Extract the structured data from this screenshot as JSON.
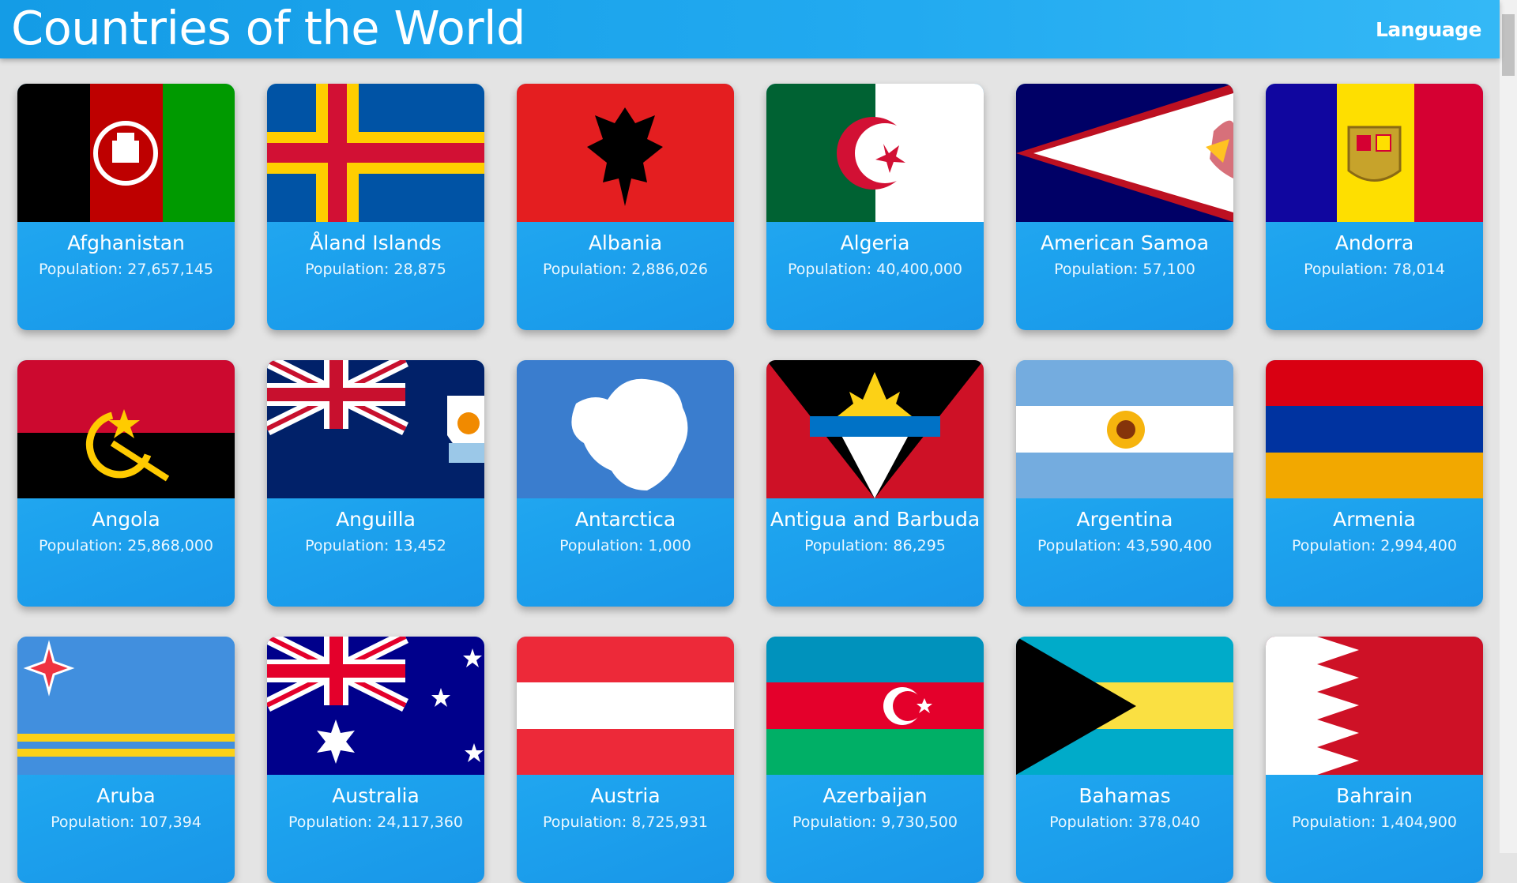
{
  "header": {
    "title": "Countries of the World",
    "language_label": "Language"
  },
  "population_prefix": "Population: ",
  "countries": [
    {
      "name": "Afghanistan",
      "population": "27,657,145",
      "flag_icon": "flag-afghanistan-icon"
    },
    {
      "name": "Åland Islands",
      "population": "28,875",
      "flag_icon": "flag-aland-islands-icon"
    },
    {
      "name": "Albania",
      "population": "2,886,026",
      "flag_icon": "flag-albania-icon"
    },
    {
      "name": "Algeria",
      "population": "40,400,000",
      "flag_icon": "flag-algeria-icon"
    },
    {
      "name": "American Samoa",
      "population": "57,100",
      "flag_icon": "flag-american-samoa-icon"
    },
    {
      "name": "Andorra",
      "population": "78,014",
      "flag_icon": "flag-andorra-icon"
    },
    {
      "name": "Angola",
      "population": "25,868,000",
      "flag_icon": "flag-angola-icon"
    },
    {
      "name": "Anguilla",
      "population": "13,452",
      "flag_icon": "flag-anguilla-icon"
    },
    {
      "name": "Antarctica",
      "population": "1,000",
      "flag_icon": "flag-antarctica-icon"
    },
    {
      "name": "Antigua and Barbuda",
      "population": "86,295",
      "flag_icon": "flag-antigua-and-barbuda-icon"
    },
    {
      "name": "Argentina",
      "population": "43,590,400",
      "flag_icon": "flag-argentina-icon"
    },
    {
      "name": "Armenia",
      "population": "2,994,400",
      "flag_icon": "flag-armenia-icon"
    },
    {
      "name": "Aruba",
      "population": "107,394",
      "flag_icon": "flag-aruba-icon"
    },
    {
      "name": "Australia",
      "population": "24,117,360",
      "flag_icon": "flag-australia-icon"
    },
    {
      "name": "Austria",
      "population": "8,725,931",
      "flag_icon": "flag-austria-icon"
    },
    {
      "name": "Azerbaijan",
      "population": "9,730,500",
      "flag_icon": "flag-azerbaijan-icon"
    },
    {
      "name": "Bahamas",
      "population": "378,040",
      "flag_icon": "flag-bahamas-icon"
    },
    {
      "name": "Bahrain",
      "population": "1,404,900",
      "flag_icon": "flag-bahrain-icon"
    }
  ],
  "colors": {
    "app_bar": "#1fa5ee",
    "card": "#22a7f0",
    "page_background": "#e4e4e4"
  }
}
